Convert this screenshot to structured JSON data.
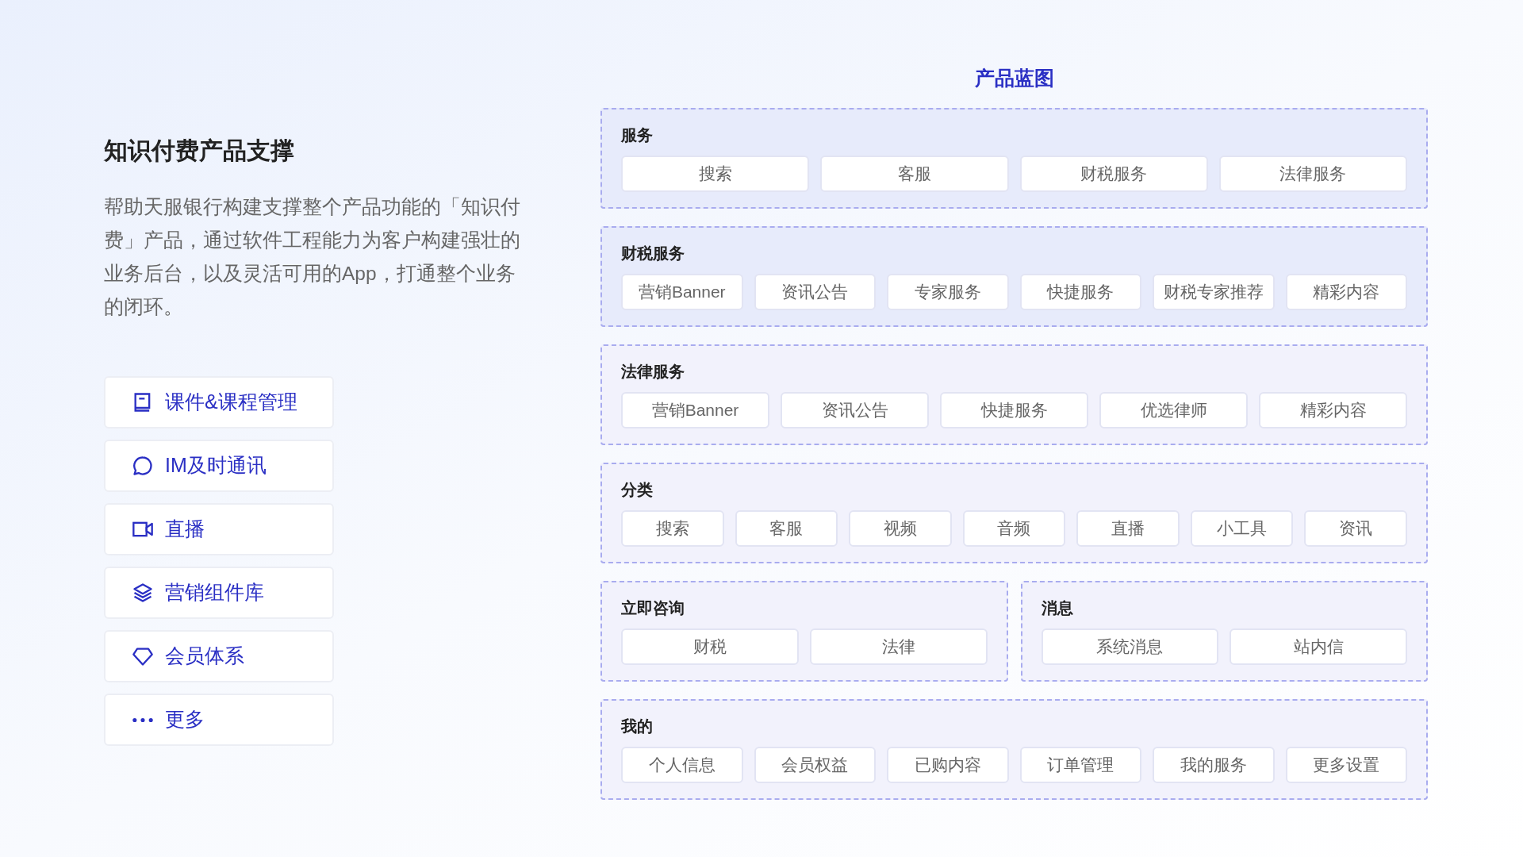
{
  "intro": {
    "title": "知识付费产品支撑",
    "description": "帮助天服银行构建支撑整个产品功能的「知识付费」产品，通过软件工程能力为客户构建强壮的业务后台，以及灵活可用的App，打通整个业务的闭环。"
  },
  "features": [
    {
      "label": "课件&课程管理",
      "kind": "book"
    },
    {
      "label": "IM及时通讯",
      "kind": "chat"
    },
    {
      "label": "直播",
      "kind": "video"
    },
    {
      "label": "营销组件库",
      "kind": "layers"
    },
    {
      "label": "会员体系",
      "kind": "diamond"
    },
    {
      "label": "更多",
      "kind": "more"
    }
  ],
  "blueprint": {
    "title": "产品蓝图",
    "rows": [
      [
        {
          "title": "服务",
          "items": [
            "搜索",
            "客服",
            "财税服务",
            "法律服务"
          ]
        }
      ],
      [
        {
          "title": "财税服务",
          "items": [
            "营销Banner",
            "资讯公告",
            "专家服务",
            "快捷服务",
            "财税专家推荐",
            "精彩内容"
          ]
        }
      ],
      [
        {
          "title": "法律服务",
          "items": [
            "营销Banner",
            "资讯公告",
            "快捷服务",
            "优选律师",
            "精彩内容"
          ]
        }
      ],
      [
        {
          "title": "分类",
          "items": [
            "搜索",
            "客服",
            "视频",
            "音频",
            "直播",
            "小工具",
            "资讯"
          ]
        }
      ],
      [
        {
          "title": "立即咨询",
          "items": [
            "财税",
            "法律"
          ]
        },
        {
          "title": "消息",
          "items": [
            "系统消息",
            "站内信"
          ]
        }
      ],
      [
        {
          "title": "我的",
          "items": [
            "个人信息",
            "会员权益",
            "已购内容",
            "订单管理",
            "我的服务",
            "更多设置"
          ]
        }
      ]
    ]
  }
}
